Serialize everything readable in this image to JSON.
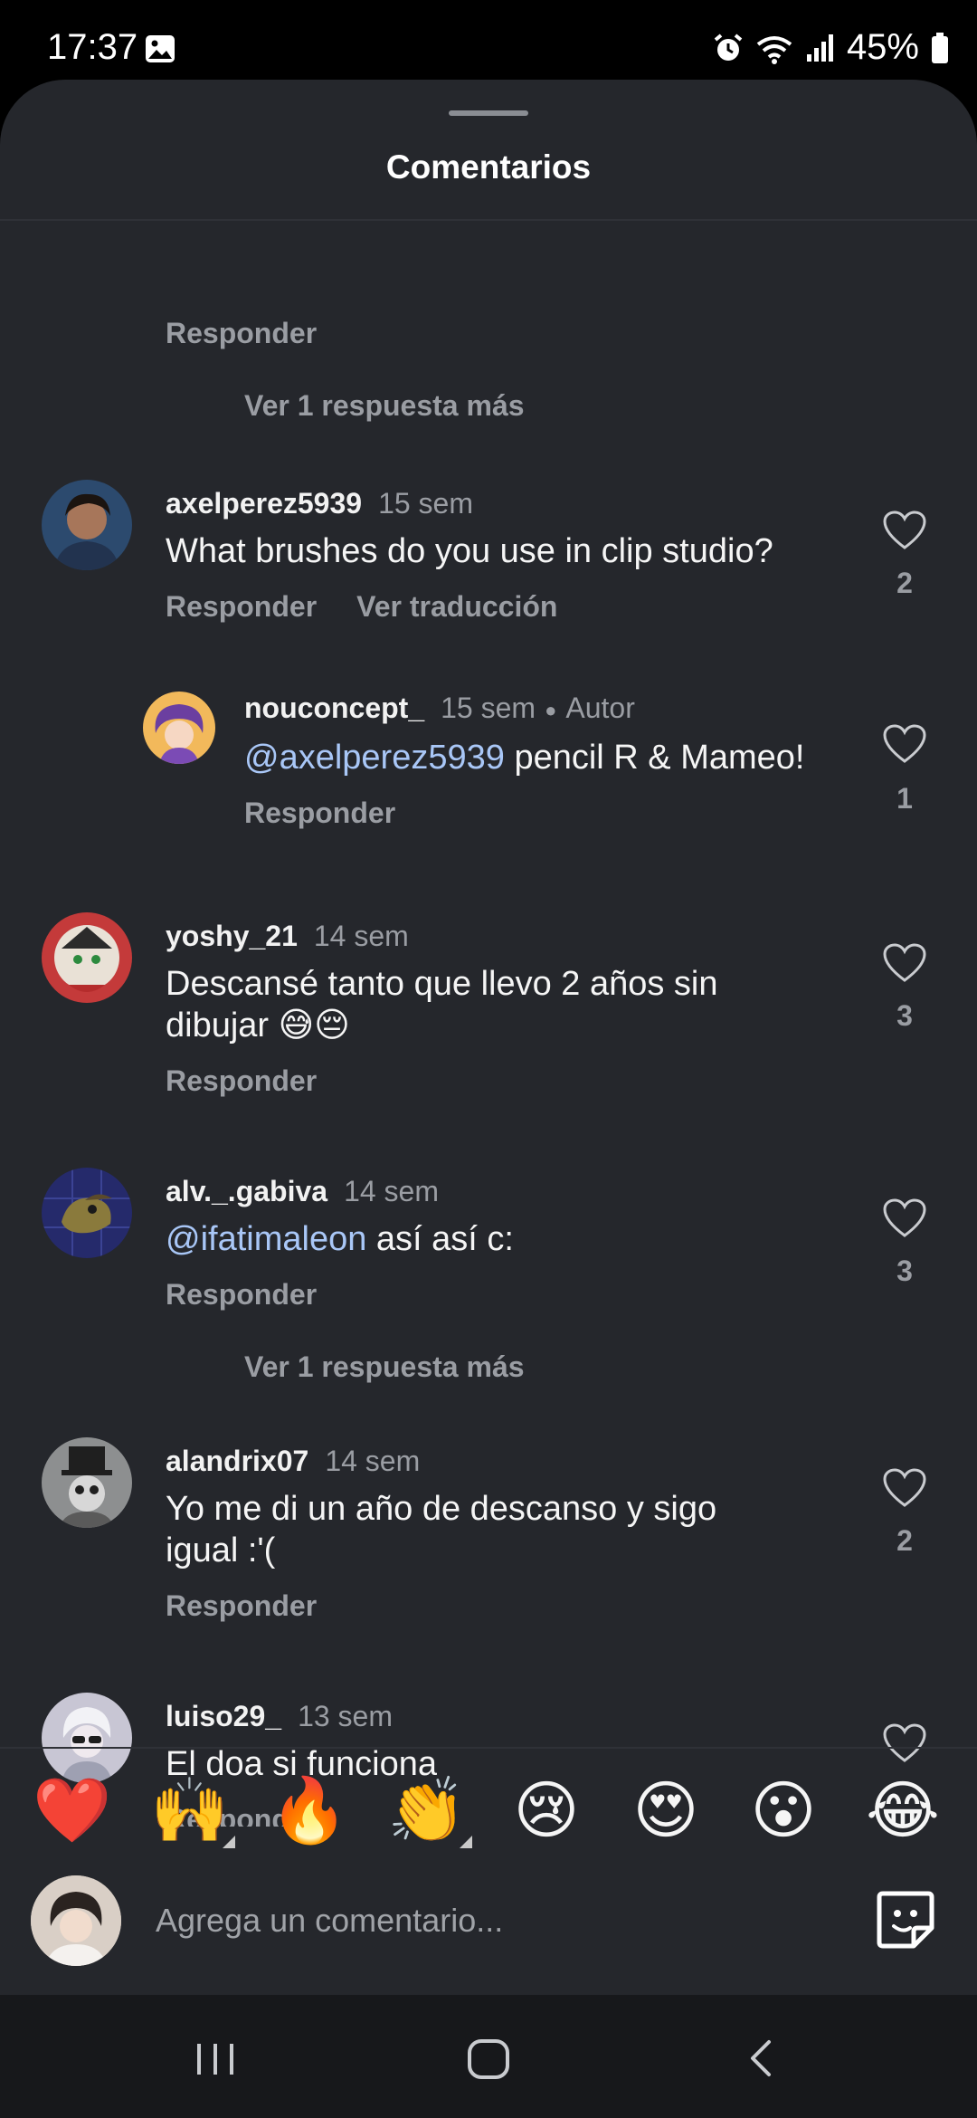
{
  "status_bar": {
    "time": "17:37",
    "battery": "45%"
  },
  "sheet": {
    "title": "Comentarios"
  },
  "top_partial": {
    "reply_label": "Responder",
    "more_replies": "Ver 1 respuesta más"
  },
  "comments": [
    {
      "user": "axelperez5939",
      "time": "15 sem",
      "text": "What brushes do you use in clip studio?",
      "reply_label": "Responder",
      "translate_label": "Ver traducción",
      "likes": "2"
    },
    {
      "user": "nouconcept_",
      "time": "15 sem",
      "author_tag": "Autor",
      "mention": "@axelperez5939",
      "text": " pencil R & Mameo!",
      "reply_label": "Responder",
      "likes": "1"
    },
    {
      "user": "yoshy_21",
      "time": "14 sem",
      "text": "Descansé tanto que llevo 2 años sin dibujar 😅😔",
      "reply_label": "Responder",
      "likes": "3"
    },
    {
      "user": "alv._.gabiva",
      "time": "14 sem",
      "mention": "@ifatimaleon",
      "text": " así así c:",
      "reply_label": "Responder",
      "likes": "3",
      "more_replies": "Ver 1 respuesta más"
    },
    {
      "user": "alandrix07",
      "time": "14 sem",
      "text": "Yo me di un año de descanso y sigo igual :'(",
      "reply_label": "Responder",
      "likes": "2"
    },
    {
      "user": "luiso29_",
      "time": "13 sem",
      "text": "El doa si funciona",
      "reply_label": "Responder"
    }
  ],
  "emoji_bar": [
    "❤️",
    "🙌",
    "🔥",
    "👏",
    "😢",
    "😍",
    "😮",
    "😂"
  ],
  "composer": {
    "placeholder": "Agrega un comentario..."
  }
}
